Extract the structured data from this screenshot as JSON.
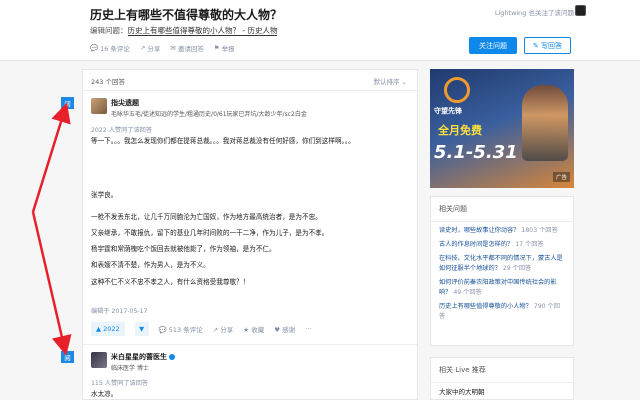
{
  "header": {
    "title": "历史上有哪些不值得尊敬的大人物？",
    "edit_label": "编辑问题：",
    "edit_text": "历史上有哪些值得尊敬的小人物？ - 历史人物",
    "comments": "16 条评论",
    "share": "分享",
    "invite": "邀请回答",
    "report": "举报",
    "followers_text": "Lightwing 也关注了该问题",
    "follow_btn": "关注问题",
    "answer_btn": "写回答"
  },
  "side_tag": "阅",
  "answers": {
    "count": "243 个回答",
    "sort": "默认排序 ⌄",
    "first": {
      "author": "指尖遗题",
      "bio": "毛咏华五毛/徒述知远的学生/粗通历史/0/61玩家已弃坑/大龄少年/sc2白金",
      "likers": "2022 人赞同了该回答",
      "p1": "等一下。。。我怎么发现你们都在提蒋总裁。。。我对蒋总裁没有任何好感，你们到这样啊。。。",
      "p2": "张学良。",
      "p3": "一枪不发丢东北，让几千万同胞沦为亡国奴，作为地方最高统治者，是为不忠。",
      "p4": "又亲继承，不敢报仇，留下的基业几年时间败的一干二净，作为儿子，是为不孝。",
      "p5": "杨宇霆和常荫槐吃个饭回去就被他毙了，作为领袖，是为不仁。",
      "p6": "和表嫂不清不楚，作为男人，是为不义。",
      "p7": "这种不仁不义不忠不孝之人，有什么资格受我尊敬？！",
      "edited": "编辑于 2017-05-17",
      "votes": "▲ 2022",
      "comments": "513 条评论",
      "share": "分享",
      "fav": "收藏",
      "thanks": "感谢",
      "more": "···"
    },
    "second": {
      "author": "米白星星的蔷医生",
      "bio": "临床医学 博士",
      "likers": "115 人赞同了该回答",
      "p1": "水太凉。"
    }
  },
  "banner": {
    "title": "守望先锋",
    "free": "全月免费",
    "date": "5.1-5.31",
    "ad": "广告"
  },
  "related": {
    "title": "相关问题",
    "items": [
      {
        "t": "读史时，哪些故事让你动容？",
        "m": "1803 个回答"
      },
      {
        "t": "古人的作息时间是怎样的？",
        "m": "17 个回答"
      },
      {
        "t": "在科技、文化水平都不同的情况下，蒙古人是如何征服半个地球的？",
        "m": "29 个回答"
      },
      {
        "t": "如何评价前秦农阳政策对中国传统社会的影响？",
        "m": "49 个回答"
      },
      {
        "t": "历史上有哪些值得尊敬的小人物？",
        "m": "790 个回答"
      }
    ]
  },
  "live": {
    "title": "相关 Live 推荐",
    "item": "大家中的大明朝"
  }
}
